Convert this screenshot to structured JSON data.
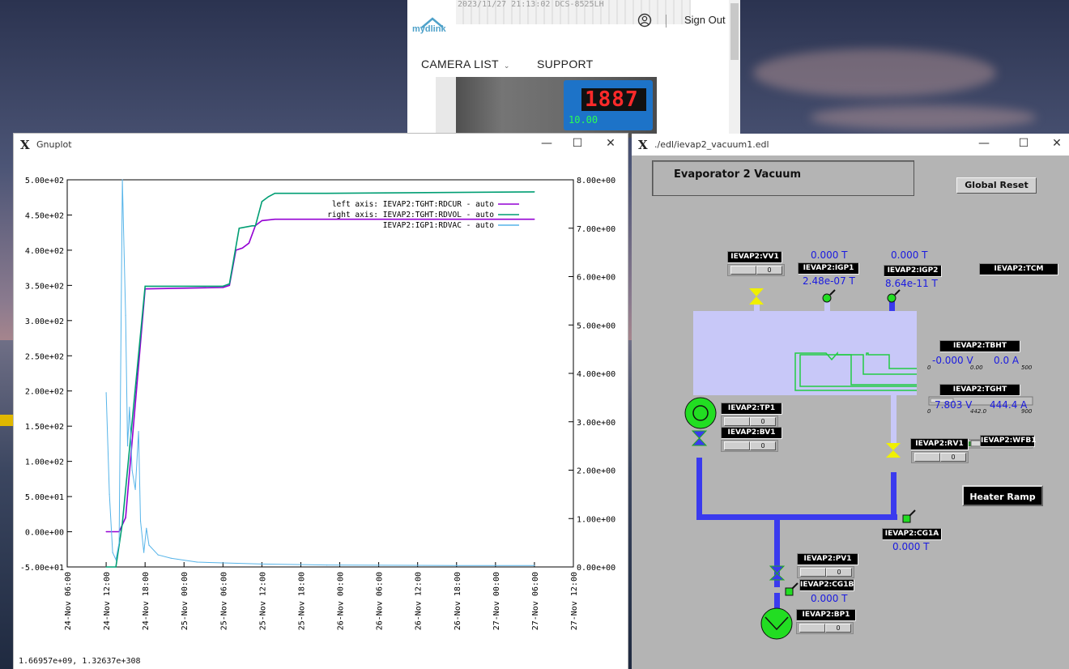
{
  "browser": {
    "camera_stamp": "2023/11/27 21:13:02 DCS-8525LH",
    "logo_text": "mydlink",
    "sign_out": "Sign Out",
    "nav_camera_list": "CAMERA LIST",
    "nav_support": "SUPPORT",
    "meter_value": "1887",
    "meter_setpoint": "10.00"
  },
  "gnuplot": {
    "title": "Gnuplot",
    "status_readout": "1.66957e+09,  1.32637e+308"
  },
  "chart_data": {
    "type": "line",
    "title": "",
    "xlabel": "",
    "ylabel": "",
    "x_ticks": [
      "24-Nov 06:00",
      "24-Nov 12:00",
      "24-Nov 18:00",
      "25-Nov 00:00",
      "25-Nov 06:00",
      "25-Nov 12:00",
      "25-Nov 18:00",
      "26-Nov 00:00",
      "26-Nov 06:00",
      "26-Nov 12:00",
      "26-Nov 18:00",
      "27-Nov 00:00",
      "27-Nov 06:00",
      "27-Nov 12:00"
    ],
    "y_left_ticks": [
      "5.00e+02",
      "4.50e+02",
      "4.00e+02",
      "3.50e+02",
      "3.00e+02",
      "2.50e+02",
      "2.00e+02",
      "1.50e+02",
      "1.00e+02",
      "5.00e+01",
      "0.00e+00",
      "-5.00e+01"
    ],
    "y_right_ticks": [
      "8.00e+00",
      "7.00e+00",
      "6.00e+00",
      "5.00e+00",
      "4.00e+00",
      "3.00e+00",
      "2.00e+00",
      "1.00e+00",
      "0.00e+00"
    ],
    "ylim_left": [
      -50,
      500
    ],
    "ylim_right": [
      0,
      8
    ],
    "xlim_hours": [
      0,
      78
    ],
    "legend_position": "top-right",
    "series": [
      {
        "name": "left axis: IEVAP2:TGHT:RDCUR  - auto",
        "axis": "left",
        "color": "#9400d3",
        "x_hours": [
          6,
          8,
          9,
          12,
          24,
          25,
          26,
          27,
          28,
          29,
          30,
          32,
          72
        ],
        "y": [
          0,
          0,
          20,
          345,
          347,
          350,
          400,
          403,
          410,
          435,
          442,
          444,
          444
        ]
      },
      {
        "name": "right axis: IEVAP2:TGHT:RDVOL  - auto",
        "axis": "right",
        "color": "#009e73",
        "x_hours": [
          6,
          7.5,
          8.5,
          12,
          24,
          25,
          26.5,
          28.5,
          29,
          30,
          31,
          32,
          40,
          72
        ],
        "y": [
          0,
          0,
          0.9,
          5.8,
          5.8,
          5.85,
          7.0,
          7.05,
          7.05,
          7.55,
          7.65,
          7.72,
          7.72,
          7.75
        ]
      },
      {
        "name": "IEVAP2:IGP1:RDVAC  - auto",
        "axis": "right",
        "color": "#56b4e9",
        "x_hours": [
          6,
          6.5,
          7,
          7.5,
          8,
          8.5,
          9,
          9.3,
          9.6,
          10,
          10.5,
          11,
          11.3,
          11.8,
          12.2,
          12.6,
          14,
          16,
          20,
          30,
          40,
          60,
          72
        ],
        "y": [
          3.6,
          1.5,
          0.3,
          0.15,
          0.5,
          8.0,
          5.2,
          2.5,
          3.3,
          2.0,
          1.6,
          2.8,
          0.95,
          0.3,
          0.8,
          0.45,
          0.25,
          0.18,
          0.1,
          0.06,
          0.04,
          0.03,
          0.03
        ]
      }
    ]
  },
  "edm": {
    "window_title": "./edl/ievap2_vacuum1.edl",
    "panel_title": "Evaporator 2 Vacuum",
    "global_reset": "Global Reset",
    "heater_ramp": "Heater Ramp",
    "tags": {
      "vv1": "IEVAP2:VV1",
      "igp1": "IEVAP2:IGP1",
      "igp2": "IEVAP2:IGP2",
      "tcm": "IEVAP2:TCM",
      "tbht": "IEVAP2:TBHT",
      "tght": "IEVAP2:TGHT",
      "tp1": "IEVAP2:TP1",
      "bv1": "IEVAP2:BV1",
      "rv1": "IEVAP2:RV1",
      "wfb1": "IEVAP2:WFB1",
      "cg1a": "IEVAP2:CG1A",
      "pv1": "IEVAP2:PV1",
      "cg1b": "IEVAP2:CG1B",
      "bp1": "IEVAP2:BP1"
    },
    "values": {
      "igp1_top": "0.000 T",
      "igp1": "2.48e-07 T",
      "igp2_top": "0.000 T",
      "igp2": "8.64e-11 T",
      "tbht_v": "-0.000 V",
      "tbht_a": "0.0 A",
      "tght_v": "7.803 V",
      "tght_a": "444.4 A",
      "cg1a": "0.000 T",
      "cg1b": "0.000 T"
    },
    "scale_tbht": {
      "min": "0",
      "mid": "0.00",
      "max": "500",
      "fill_fraction": 0.0
    },
    "scale_tght": {
      "min": "0",
      "mid": "442.0",
      "max": "900",
      "fill_fraction": 0.49
    },
    "button_label": "0",
    "colors": {
      "chamber": "#c8c8f8",
      "pipe": "#3a3aee",
      "pump": "#22dd22",
      "valve": "#f0f000",
      "heater_wire": "#22cc44"
    }
  }
}
